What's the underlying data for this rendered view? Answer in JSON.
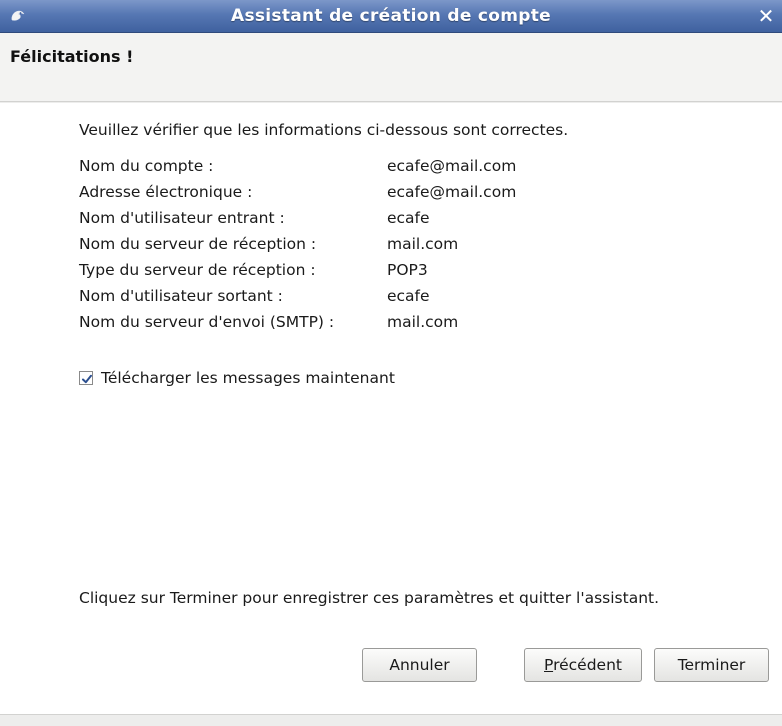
{
  "window": {
    "title": "Assistant de création de compte",
    "close_glyph": "✕",
    "app_icon": "thunderbird-icon"
  },
  "header": {
    "heading": "Félicitations !"
  },
  "content": {
    "intro": "Veuillez vérifier que les informations ci-dessous sont correctes.",
    "rows": [
      {
        "label": "Nom du compte :",
        "value": "ecafe@mail.com"
      },
      {
        "label": "Adresse électronique :",
        "value": "ecafe@mail.com"
      },
      {
        "label": "Nom d'utilisateur entrant :",
        "value": "ecafe"
      },
      {
        "label": "Nom du serveur de réception :",
        "value": "mail.com"
      },
      {
        "label": "Type du serveur de réception :",
        "value": "POP3"
      },
      {
        "label": "Nom d'utilisateur sortant :",
        "value": "ecafe"
      },
      {
        "label": "Nom du serveur d'envoi (SMTP) :",
        "value": "mail.com"
      }
    ],
    "download_checkbox": {
      "label": "Télécharger les messages maintenant",
      "checked": true
    },
    "footer": "Cliquez sur Terminer pour enregistrer ces paramètres et quitter l'assistant."
  },
  "buttons": {
    "cancel": "Annuler",
    "previous": "Précédent",
    "finish": "Terminer"
  },
  "colors": {
    "titlebar": "#5677b3",
    "checkmark": "#2c4f8f"
  }
}
